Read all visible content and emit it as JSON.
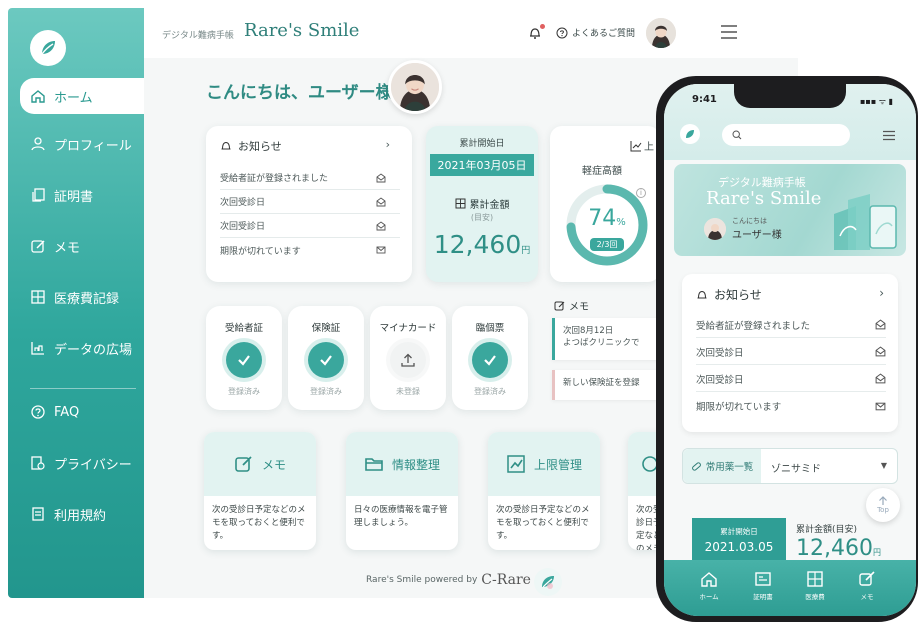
{
  "colors": {
    "brand": "#3aa79d",
    "brand_dark": "#2f8f86",
    "sidebar_top": "#6cc9c0",
    "sidebar_bottom": "#22968d",
    "alert_dot": "#e06060"
  },
  "sidebar": {
    "items": [
      {
        "label": "ホーム",
        "icon": "home-icon",
        "active": true
      },
      {
        "label": "プロフィール",
        "icon": "user-icon"
      },
      {
        "label": "証明書",
        "icon": "documents-icon"
      },
      {
        "label": "メモ",
        "icon": "edit-icon"
      },
      {
        "label": "医療費記録",
        "icon": "grid-icon"
      },
      {
        "label": "データの広場",
        "icon": "chart-icon"
      },
      {
        "label": "FAQ",
        "icon": "question-icon"
      },
      {
        "label": "プライバシー",
        "icon": "privacy-icon"
      },
      {
        "label": "利用規約",
        "icon": "terms-icon"
      }
    ]
  },
  "header": {
    "subtitle": "デジタル難病手帳",
    "title": "Rare's Smile",
    "faq": "よくあるご質問"
  },
  "greeting": "こんにちは、ユーザー様",
  "notices": {
    "title": "お知らせ",
    "items": [
      "受給者証が登録されました",
      "次回受診日",
      "次回受診日",
      "期限が切れています"
    ]
  },
  "summary": {
    "start_label": "累計開始日",
    "start_date": "2021年03月05日",
    "total_label": "累計金額",
    "total_sub": "(目安)",
    "total_amount": "12,460",
    "total_unit": "円"
  },
  "ratio": {
    "chart_link": "上",
    "title": "軽症高額",
    "percent": "74",
    "percent_unit": "%",
    "percent_value": 74,
    "fraction": "2/3回"
  },
  "documents": [
    {
      "title": "受給者証",
      "state": "登録済み",
      "done": true
    },
    {
      "title": "保険証",
      "state": "登録済み",
      "done": true
    },
    {
      "title": "マイナカード",
      "state": "未登録",
      "done": false
    },
    {
      "title": "臨個票",
      "state": "登録済み",
      "done": true
    }
  ],
  "memo": {
    "title": "メモ",
    "items": [
      {
        "line1": "次回8月12日",
        "line2": "よつばクリニックで"
      },
      {
        "line1": "新しい保険証を登録"
      }
    ]
  },
  "features": [
    {
      "title": "メモ",
      "icon": "edit-icon",
      "desc": "次の受診日予定などのメモを取っておくと便利です。"
    },
    {
      "title": "情報整理",
      "icon": "folder-icon",
      "desc": "日々の医療情報を電子管理しましょう。"
    },
    {
      "title": "上限管理",
      "icon": "trend-icon",
      "desc": "次の受診日予定などのメモを取っておくと便利です。"
    },
    {
      "title": "",
      "icon": "clock-icon",
      "desc": "次の受診日予定などのメモを取っておくと便利です。"
    }
  ],
  "footer": {
    "text": "Rare's Smile powered by",
    "brand": "C-Rare"
  },
  "phone": {
    "time": "9:41",
    "status": "▪▪▪ ᯤ ▮",
    "hero_subtitle": "デジタル難病手帳",
    "hero_title": "Rare's Smile",
    "hello": "こんにちは",
    "user": "ユーザー様",
    "notice_title": "お知らせ",
    "notices": [
      "受給者証が登録されました",
      "次回受診日",
      "次回受診日",
      "期限が切れています"
    ],
    "med_label": "常用薬一覧",
    "med_value": "ゾニサミド",
    "top": "Top",
    "start_label": "累計開始日",
    "start_date": "2021.03.05",
    "total_label": "累計金額(目安)",
    "total_amount": "12,460",
    "total_unit": "円",
    "tabs": [
      "ホーム",
      "証明書",
      "医療費",
      "メモ"
    ]
  }
}
